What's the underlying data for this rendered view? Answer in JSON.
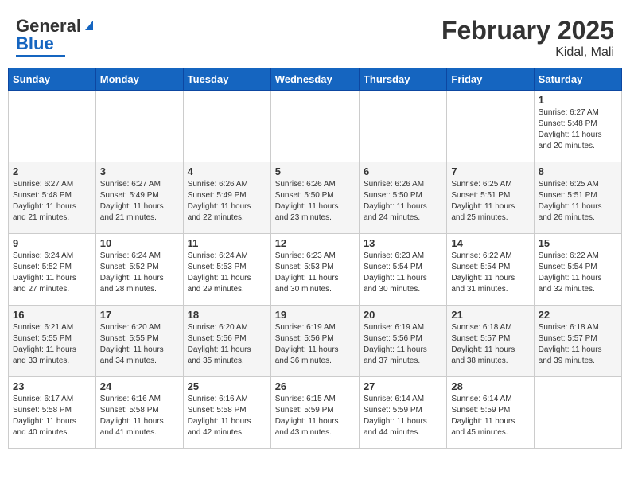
{
  "header": {
    "logo_general": "General",
    "logo_blue": "Blue",
    "title": "February 2025",
    "subtitle": "Kidal, Mali"
  },
  "calendar": {
    "days_of_week": [
      "Sunday",
      "Monday",
      "Tuesday",
      "Wednesday",
      "Thursday",
      "Friday",
      "Saturday"
    ],
    "weeks": [
      [
        {
          "day": "",
          "info": ""
        },
        {
          "day": "",
          "info": ""
        },
        {
          "day": "",
          "info": ""
        },
        {
          "day": "",
          "info": ""
        },
        {
          "day": "",
          "info": ""
        },
        {
          "day": "",
          "info": ""
        },
        {
          "day": "1",
          "info": "Sunrise: 6:27 AM\nSunset: 5:48 PM\nDaylight: 11 hours\nand 20 minutes."
        }
      ],
      [
        {
          "day": "2",
          "info": "Sunrise: 6:27 AM\nSunset: 5:48 PM\nDaylight: 11 hours\nand 21 minutes."
        },
        {
          "day": "3",
          "info": "Sunrise: 6:27 AM\nSunset: 5:49 PM\nDaylight: 11 hours\nand 21 minutes."
        },
        {
          "day": "4",
          "info": "Sunrise: 6:26 AM\nSunset: 5:49 PM\nDaylight: 11 hours\nand 22 minutes."
        },
        {
          "day": "5",
          "info": "Sunrise: 6:26 AM\nSunset: 5:50 PM\nDaylight: 11 hours\nand 23 minutes."
        },
        {
          "day": "6",
          "info": "Sunrise: 6:26 AM\nSunset: 5:50 PM\nDaylight: 11 hours\nand 24 minutes."
        },
        {
          "day": "7",
          "info": "Sunrise: 6:25 AM\nSunset: 5:51 PM\nDaylight: 11 hours\nand 25 minutes."
        },
        {
          "day": "8",
          "info": "Sunrise: 6:25 AM\nSunset: 5:51 PM\nDaylight: 11 hours\nand 26 minutes."
        }
      ],
      [
        {
          "day": "9",
          "info": "Sunrise: 6:24 AM\nSunset: 5:52 PM\nDaylight: 11 hours\nand 27 minutes."
        },
        {
          "day": "10",
          "info": "Sunrise: 6:24 AM\nSunset: 5:52 PM\nDaylight: 11 hours\nand 28 minutes."
        },
        {
          "day": "11",
          "info": "Sunrise: 6:24 AM\nSunset: 5:53 PM\nDaylight: 11 hours\nand 29 minutes."
        },
        {
          "day": "12",
          "info": "Sunrise: 6:23 AM\nSunset: 5:53 PM\nDaylight: 11 hours\nand 30 minutes."
        },
        {
          "day": "13",
          "info": "Sunrise: 6:23 AM\nSunset: 5:54 PM\nDaylight: 11 hours\nand 30 minutes."
        },
        {
          "day": "14",
          "info": "Sunrise: 6:22 AM\nSunset: 5:54 PM\nDaylight: 11 hours\nand 31 minutes."
        },
        {
          "day": "15",
          "info": "Sunrise: 6:22 AM\nSunset: 5:54 PM\nDaylight: 11 hours\nand 32 minutes."
        }
      ],
      [
        {
          "day": "16",
          "info": "Sunrise: 6:21 AM\nSunset: 5:55 PM\nDaylight: 11 hours\nand 33 minutes."
        },
        {
          "day": "17",
          "info": "Sunrise: 6:20 AM\nSunset: 5:55 PM\nDaylight: 11 hours\nand 34 minutes."
        },
        {
          "day": "18",
          "info": "Sunrise: 6:20 AM\nSunset: 5:56 PM\nDaylight: 11 hours\nand 35 minutes."
        },
        {
          "day": "19",
          "info": "Sunrise: 6:19 AM\nSunset: 5:56 PM\nDaylight: 11 hours\nand 36 minutes."
        },
        {
          "day": "20",
          "info": "Sunrise: 6:19 AM\nSunset: 5:56 PM\nDaylight: 11 hours\nand 37 minutes."
        },
        {
          "day": "21",
          "info": "Sunrise: 6:18 AM\nSunset: 5:57 PM\nDaylight: 11 hours\nand 38 minutes."
        },
        {
          "day": "22",
          "info": "Sunrise: 6:18 AM\nSunset: 5:57 PM\nDaylight: 11 hours\nand 39 minutes."
        }
      ],
      [
        {
          "day": "23",
          "info": "Sunrise: 6:17 AM\nSunset: 5:58 PM\nDaylight: 11 hours\nand 40 minutes."
        },
        {
          "day": "24",
          "info": "Sunrise: 6:16 AM\nSunset: 5:58 PM\nDaylight: 11 hours\nand 41 minutes."
        },
        {
          "day": "25",
          "info": "Sunrise: 6:16 AM\nSunset: 5:58 PM\nDaylight: 11 hours\nand 42 minutes."
        },
        {
          "day": "26",
          "info": "Sunrise: 6:15 AM\nSunset: 5:59 PM\nDaylight: 11 hours\nand 43 minutes."
        },
        {
          "day": "27",
          "info": "Sunrise: 6:14 AM\nSunset: 5:59 PM\nDaylight: 11 hours\nand 44 minutes."
        },
        {
          "day": "28",
          "info": "Sunrise: 6:14 AM\nSunset: 5:59 PM\nDaylight: 11 hours\nand 45 minutes."
        },
        {
          "day": "",
          "info": ""
        }
      ]
    ]
  }
}
